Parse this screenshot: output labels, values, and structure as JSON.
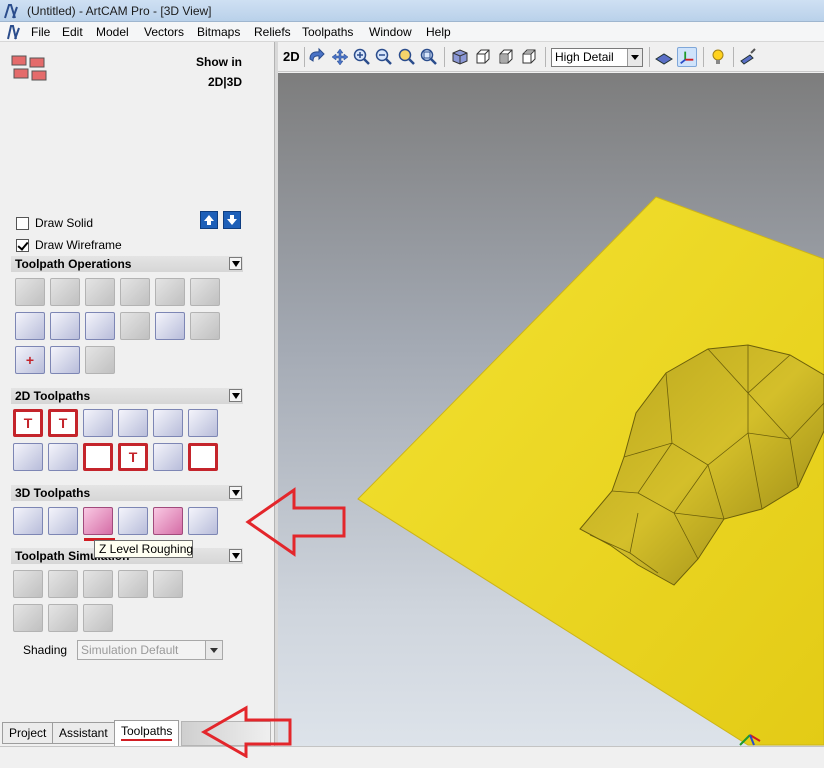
{
  "window": {
    "title": "(Untitled) - ArtCAM Pro - [3D View]"
  },
  "menu": {
    "items": [
      "File",
      "Edit",
      "Model",
      "Vectors",
      "Bitmaps",
      "Reliefs",
      "Toolpaths",
      "Window",
      "Help"
    ]
  },
  "left_panel": {
    "show_in_line1": "Show in",
    "show_in_line2": "2D|3D",
    "draw_solid": {
      "label": "Draw Solid",
      "checked": false
    },
    "draw_wireframe": {
      "label": "Draw Wireframe",
      "checked": true
    },
    "sections": {
      "toolpath_operations": "Toolpath Operations",
      "toolpaths_2d": "2D Toolpaths",
      "toolpaths_3d": "3D Toolpaths",
      "toolpath_simulation": "Toolpath Simulation"
    },
    "tooltip": "Z Level Roughing",
    "shading": {
      "label": "Shading",
      "value": "Simulation Default"
    },
    "tabs": [
      "Project",
      "Assistant",
      "Toolpaths"
    ],
    "active_tab": "Toolpaths"
  },
  "view_toolbar": {
    "mode_2d": "2D",
    "detail": "High Detail"
  },
  "colors": {
    "accent_red": "#d01c22",
    "relief_yellow": "#f0dc2c",
    "viewport_bg_top": "#7d7d7d",
    "viewport_bg_bottom": "#dde3ea"
  }
}
